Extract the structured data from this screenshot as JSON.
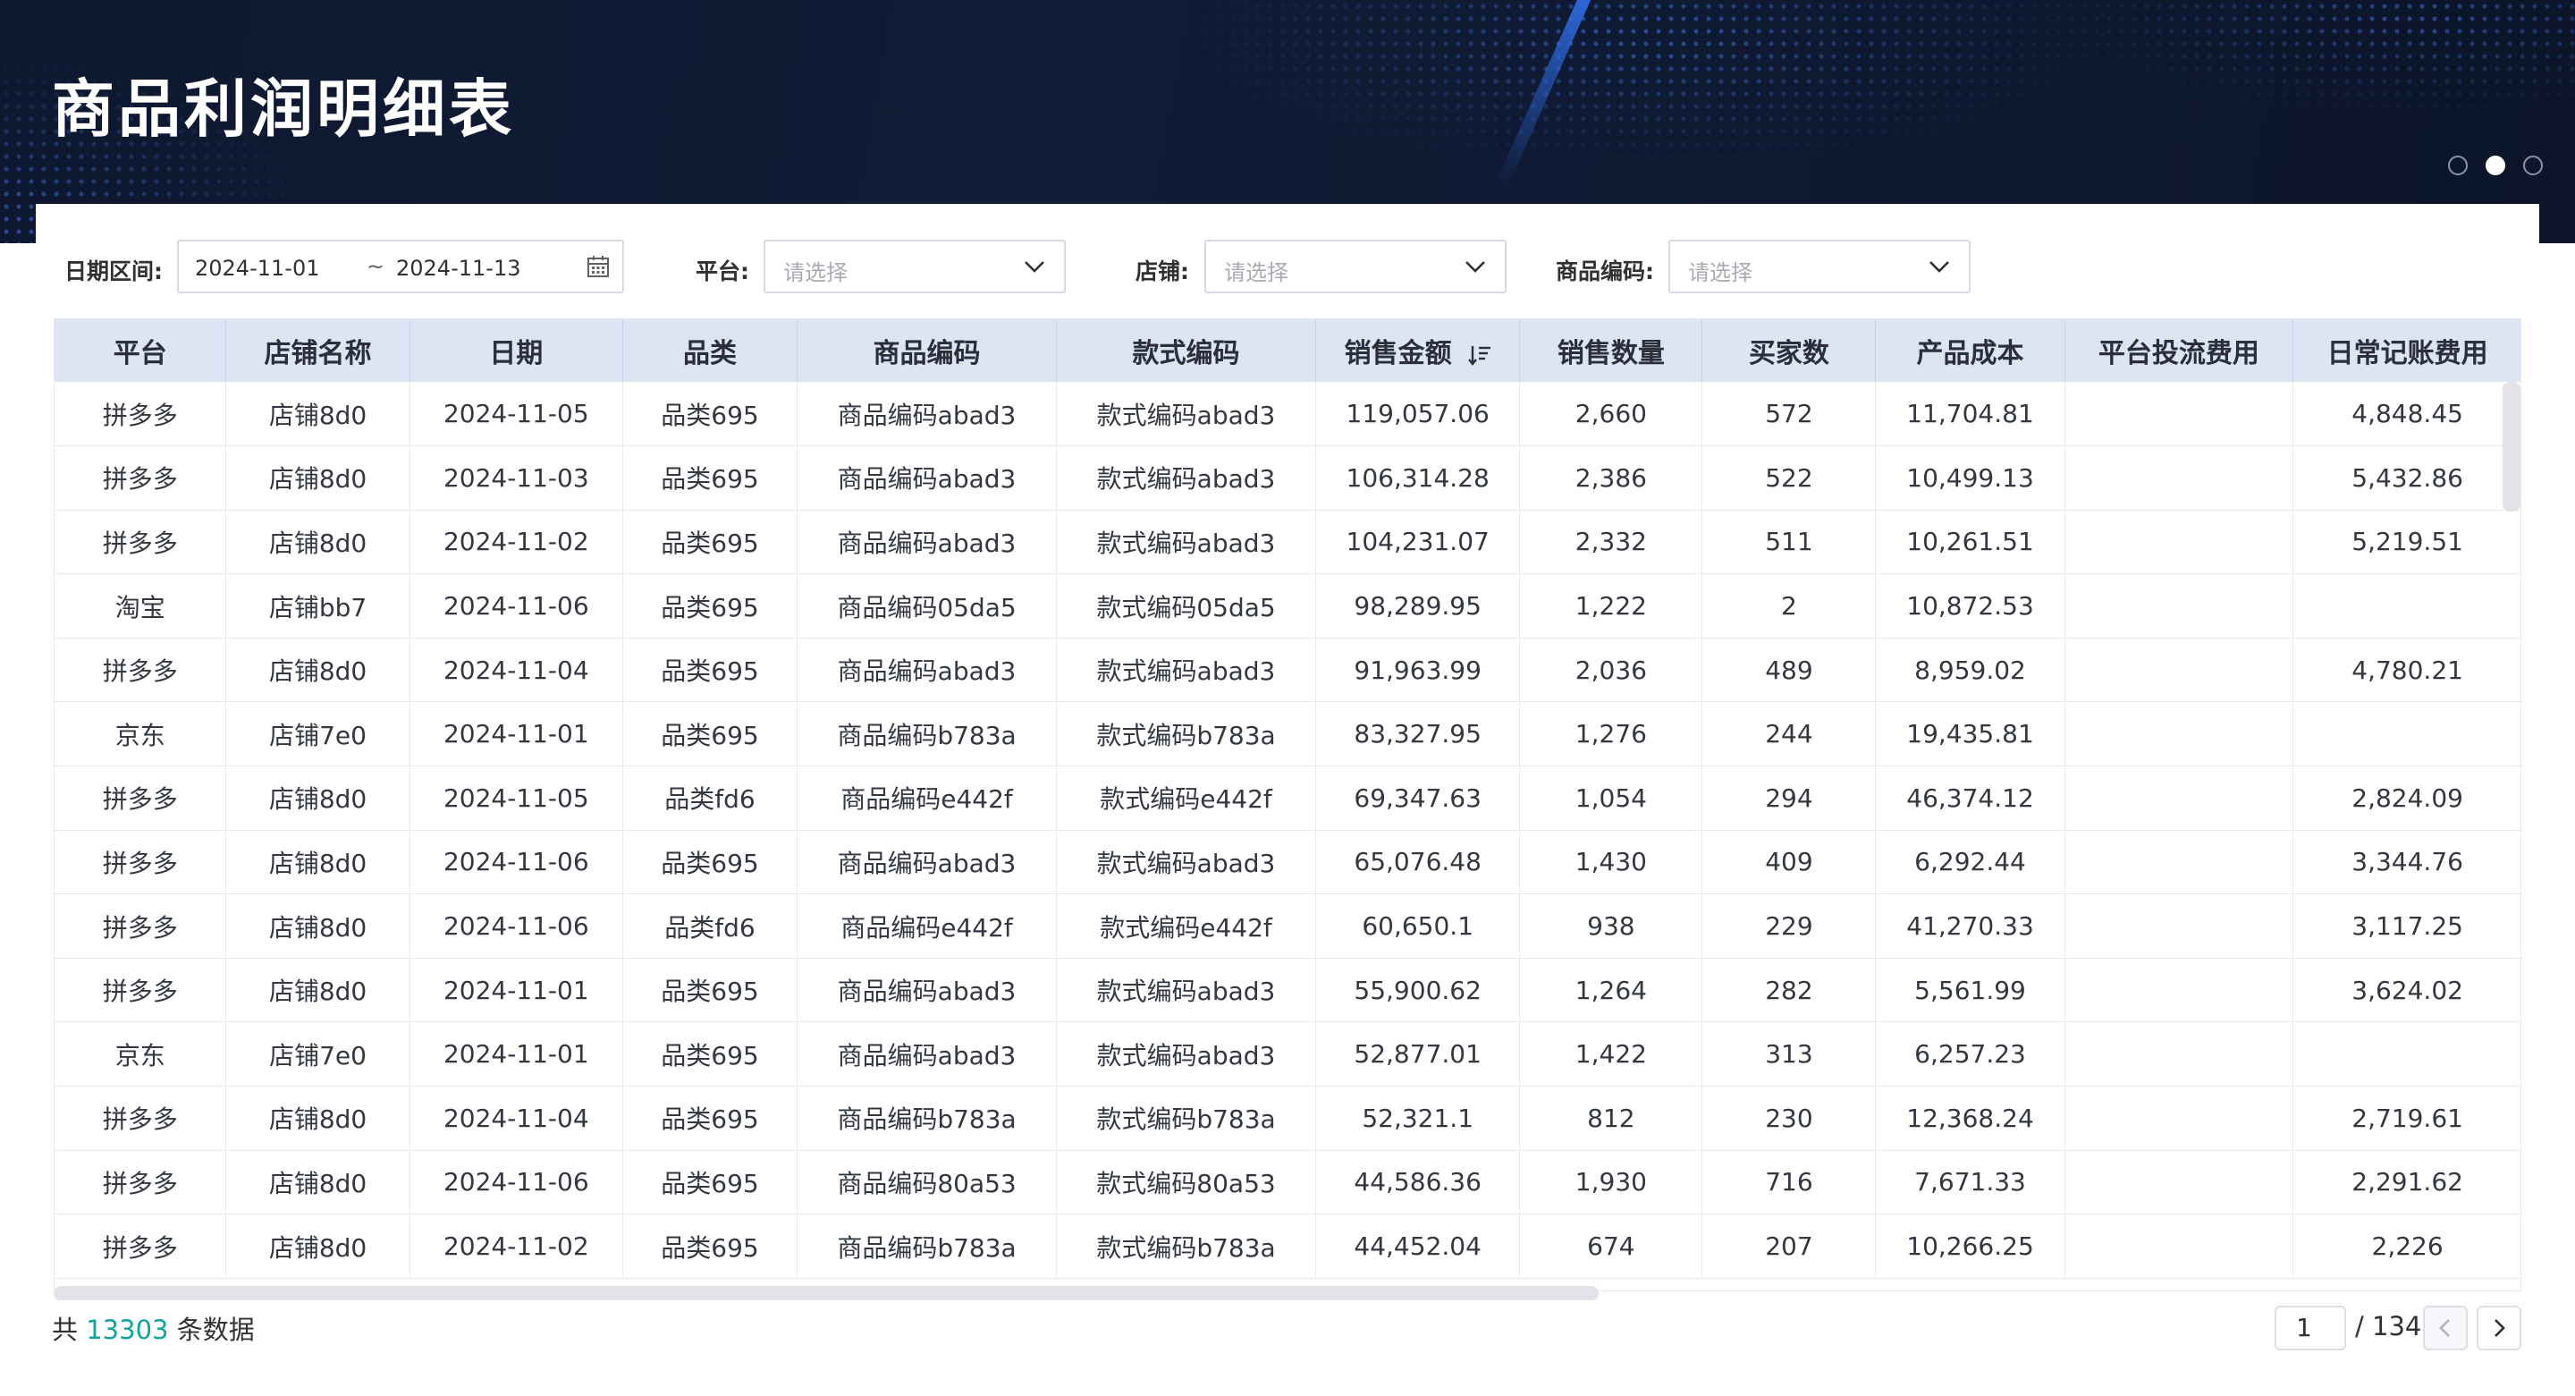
{
  "header": {
    "title": "商品利润明细表"
  },
  "filters": {
    "date_label": "日期区间:",
    "date_start": "2024-11-01",
    "date_sep": "~",
    "date_end": "2024-11-13",
    "platform_label": "平台:",
    "platform_placeholder": "请选择",
    "shop_label": "店铺:",
    "shop_placeholder": "请选择",
    "code_label": "商品编码:",
    "code_placeholder": "请选择"
  },
  "table": {
    "columns": [
      "平台",
      "店铺名称",
      "日期",
      "品类",
      "商品编码",
      "款式编码",
      "销售金额",
      "销售数量",
      "买家数",
      "产品成本",
      "平台投流费用",
      "日常记账费用"
    ],
    "rows": [
      [
        "拼多多",
        "店铺8d0",
        "2024-11-05",
        "品类695",
        "商品编码abad3",
        "款式编码abad3",
        "119,057.06",
        "2,660",
        "572",
        "11,704.81",
        "",
        "4,848.45"
      ],
      [
        "拼多多",
        "店铺8d0",
        "2024-11-03",
        "品类695",
        "商品编码abad3",
        "款式编码abad3",
        "106,314.28",
        "2,386",
        "522",
        "10,499.13",
        "",
        "5,432.86"
      ],
      [
        "拼多多",
        "店铺8d0",
        "2024-11-02",
        "品类695",
        "商品编码abad3",
        "款式编码abad3",
        "104,231.07",
        "2,332",
        "511",
        "10,261.51",
        "",
        "5,219.51"
      ],
      [
        "淘宝",
        "店铺bb7",
        "2024-11-06",
        "品类695",
        "商品编码05da5",
        "款式编码05da5",
        "98,289.95",
        "1,222",
        "2",
        "10,872.53",
        "",
        ""
      ],
      [
        "拼多多",
        "店铺8d0",
        "2024-11-04",
        "品类695",
        "商品编码abad3",
        "款式编码abad3",
        "91,963.99",
        "2,036",
        "489",
        "8,959.02",
        "",
        "4,780.21"
      ],
      [
        "京东",
        "店铺7e0",
        "2024-11-01",
        "品类695",
        "商品编码b783a",
        "款式编码b783a",
        "83,327.95",
        "1,276",
        "244",
        "19,435.81",
        "",
        ""
      ],
      [
        "拼多多",
        "店铺8d0",
        "2024-11-05",
        "品类fd6",
        "商品编码e442f",
        "款式编码e442f",
        "69,347.63",
        "1,054",
        "294",
        "46,374.12",
        "",
        "2,824.09"
      ],
      [
        "拼多多",
        "店铺8d0",
        "2024-11-06",
        "品类695",
        "商品编码abad3",
        "款式编码abad3",
        "65,076.48",
        "1,430",
        "409",
        "6,292.44",
        "",
        "3,344.76"
      ],
      [
        "拼多多",
        "店铺8d0",
        "2024-11-06",
        "品类fd6",
        "商品编码e442f",
        "款式编码e442f",
        "60,650.1",
        "938",
        "229",
        "41,270.33",
        "",
        "3,117.25"
      ],
      [
        "拼多多",
        "店铺8d0",
        "2024-11-01",
        "品类695",
        "商品编码abad3",
        "款式编码abad3",
        "55,900.62",
        "1,264",
        "282",
        "5,561.99",
        "",
        "3,624.02"
      ],
      [
        "京东",
        "店铺7e0",
        "2024-11-01",
        "品类695",
        "商品编码abad3",
        "款式编码abad3",
        "52,877.01",
        "1,422",
        "313",
        "6,257.23",
        "",
        ""
      ],
      [
        "拼多多",
        "店铺8d0",
        "2024-11-04",
        "品类695",
        "商品编码b783a",
        "款式编码b783a",
        "52,321.1",
        "812",
        "230",
        "12,368.24",
        "",
        "2,719.61"
      ],
      [
        "拼多多",
        "店铺8d0",
        "2024-11-06",
        "品类695",
        "商品编码80a53",
        "款式编码80a53",
        "44,586.36",
        "1,930",
        "716",
        "7,671.33",
        "",
        "2,291.62"
      ],
      [
        "拼多多",
        "店铺8d0",
        "2024-11-02",
        "品类695",
        "商品编码b783a",
        "款式编码b783a",
        "44,452.04",
        "674",
        "207",
        "10,266.25",
        "",
        "2,226"
      ]
    ]
  },
  "footer": {
    "total_prefix": "共",
    "total_count": "13303",
    "total_suffix": "条数据",
    "current_page": "1",
    "total_pages": "/ 134"
  },
  "icons": {
    "sort": "sort-desc-icon",
    "calendar": "calendar-icon",
    "chevron": "chevron-down-icon",
    "prev": "chevron-left-icon",
    "next": "chevron-right-icon"
  },
  "colors": {
    "banner": "#111c36",
    "table_header": "#dde5f4",
    "accent_count": "#14a39a"
  }
}
